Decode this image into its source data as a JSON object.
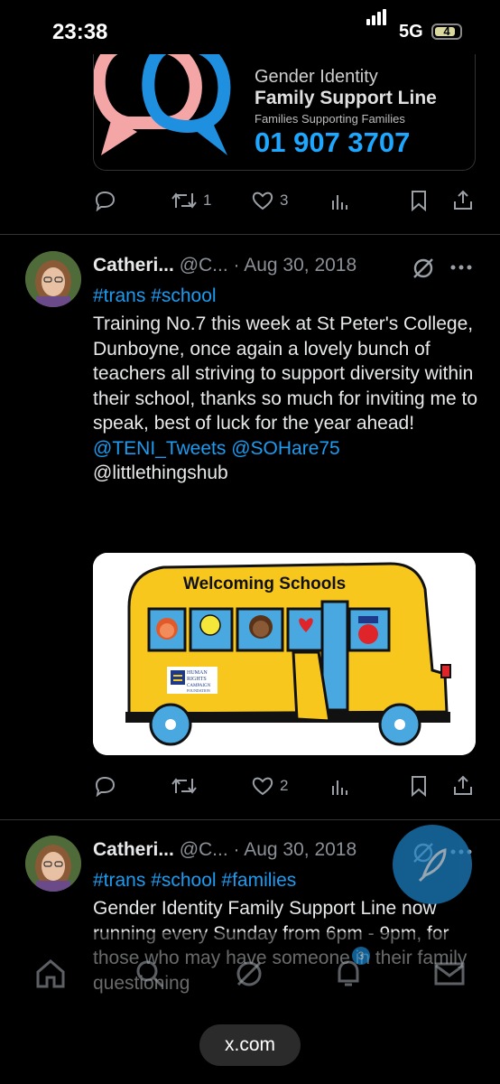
{
  "status": {
    "time": "23:38",
    "network": "5G",
    "battery": "4"
  },
  "banner": {
    "line1": "Gender Identity",
    "line2": "Family Support Line",
    "line3": "Families Supporting Families",
    "phone": "01 907 3707"
  },
  "tweet0": {
    "retweets": "1",
    "likes": "3"
  },
  "tweet1": {
    "name": "Catheri...",
    "handle": "@C...",
    "date": "· Aug 30, 2018",
    "tags": "#trans #school",
    "body": "Training No.7 this week at St Peter's College, Dunboyne, once again a lovely bunch of teachers all striving to support diversity within their school, thanks so much for inviting me to speak, best of luck for the year ahead!",
    "mentions": "@TENI_Tweets @SOHare75",
    "mention_last": "@littlethingshub",
    "image": {
      "title": "Welcoming Schools",
      "logo_line1": "HUMAN",
      "logo_line2": "RIGHTS",
      "logo_line3": "CAMPAIGN",
      "logo_line4": "FOUNDATION"
    },
    "likes": "2"
  },
  "tweet2": {
    "name": "Catheri...",
    "handle": "@C...",
    "date": "· Aug 30, 2018",
    "tags": "#trans #school #families",
    "body": "Gender Identity Family Support Line now running every Sunday from 6pm - 9pm, for those who may have someone in their family questioning"
  },
  "tabbar": {
    "notif_count": "3"
  },
  "browser": {
    "url": "x.com"
  }
}
